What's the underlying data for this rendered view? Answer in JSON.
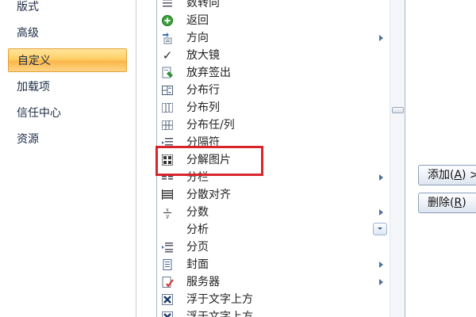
{
  "left_nav": {
    "items": [
      {
        "label": "版式",
        "active": false
      },
      {
        "label": "高级",
        "active": false
      },
      {
        "label": "自定义",
        "active": true
      },
      {
        "label": "加载项",
        "active": false
      },
      {
        "label": "信任中心",
        "active": false
      },
      {
        "label": "资源",
        "active": false
      }
    ]
  },
  "command_list": {
    "items": [
      {
        "label": "数转向",
        "icon": "lines-icon",
        "submenu": false
      },
      {
        "label": "返回",
        "icon": "back-green-icon",
        "submenu": false
      },
      {
        "label": "方向",
        "icon": "direction-icon",
        "submenu": true
      },
      {
        "label": "放大镜",
        "icon": "checkmark-icon",
        "submenu": false
      },
      {
        "label": "放弃签出",
        "icon": "discard-checkout-icon",
        "submenu": false
      },
      {
        "label": "分布行",
        "icon": "distribute-rows-icon",
        "submenu": false
      },
      {
        "label": "分布列",
        "icon": "distribute-columns-icon",
        "submenu": false
      },
      {
        "label": "分布任/列",
        "icon": "distribute-both-icon",
        "submenu": false
      },
      {
        "label": "分隔符",
        "icon": "separator-icon",
        "submenu": false
      },
      {
        "label": "分解图片",
        "icon": "ungroup-picture-icon",
        "submenu": false
      },
      {
        "label": "分栏",
        "icon": "columns-icon",
        "submenu": true
      },
      {
        "label": "分散对齐",
        "icon": "distributed-align-icon",
        "submenu": false
      },
      {
        "label": "分数",
        "icon": "fraction-icon",
        "submenu": true
      },
      {
        "label": "分析",
        "icon": "",
        "submenu": false,
        "dropdown": true
      },
      {
        "label": "分页",
        "icon": "page-break-icon",
        "submenu": false
      },
      {
        "label": "封面",
        "icon": "cover-page-icon",
        "submenu": true
      },
      {
        "label": "服务器",
        "icon": "server-icon",
        "submenu": true
      },
      {
        "label": "浮于文字上方",
        "icon": "in-front-of-text-icon",
        "submenu": false
      },
      {
        "label": "浮于文字上方",
        "icon": "in-front-of-text-icon",
        "submenu": false
      }
    ]
  },
  "buttons": {
    "add": {
      "text": "添加(",
      "key": "A",
      "suffix": ") >"
    },
    "remove": {
      "text": "删除(",
      "key": "R",
      "suffix": ")"
    }
  },
  "colors": {
    "highlight": "#d8252a",
    "active_nav": "#fbb74a",
    "arrow": "#4a6fa5"
  }
}
